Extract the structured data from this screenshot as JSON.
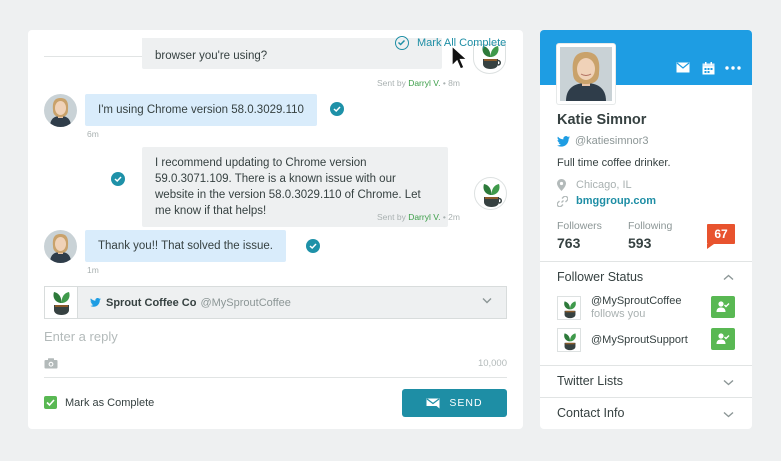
{
  "conversation": {
    "mark_all_label": "Mark All Complete",
    "messages": [
      {
        "text": "browser you're using?",
        "meta_prefix": "Sent by ",
        "agent": "Darryl V.",
        "time": " • 8m"
      },
      {
        "text": "I'm using Chrome version 58.0.3029.110",
        "time": "6m"
      },
      {
        "text": "I recommend updating to Chrome version 59.0.3071.109. There is a known issue with our website in the version 58.0.3029.110 of Chrome. Let me know if that helps!",
        "meta_prefix": "Sent by ",
        "agent": "Darryl V.",
        "time": " • 2m"
      },
      {
        "text": "Thank you!! That solved the issue.",
        "time": "1m"
      }
    ],
    "account": {
      "name": "Sprout Coffee Co",
      "handle": "@MySproutCoffee"
    },
    "reply_placeholder": "Enter a reply",
    "char_count": "10,000",
    "mark_complete_label": "Mark as Complete",
    "send_label": "SEND"
  },
  "profile": {
    "name": "Katie Simnor",
    "handle": "@katiesimnor3",
    "bio": "Full time coffee drinker.",
    "location": "Chicago, IL",
    "website": "bmggroup.com",
    "followers_label": "Followers",
    "followers": "763",
    "following_label": "Following",
    "following": "593",
    "klout": "67",
    "follower_status_title": "Follower Status",
    "follower_status": [
      {
        "handle": "@MySproutCoffee",
        "sub": "follows you"
      },
      {
        "handle": "@MySproutSupport",
        "sub": ""
      }
    ],
    "twitter_lists_title": "Twitter Lists",
    "contact_info_title": "Contact Info"
  },
  "colors": {
    "accent_teal": "#1e8ea5",
    "twitter_blue": "#1e9de3",
    "sprout_green": "#59b853",
    "klout_orange": "#e8532e"
  }
}
